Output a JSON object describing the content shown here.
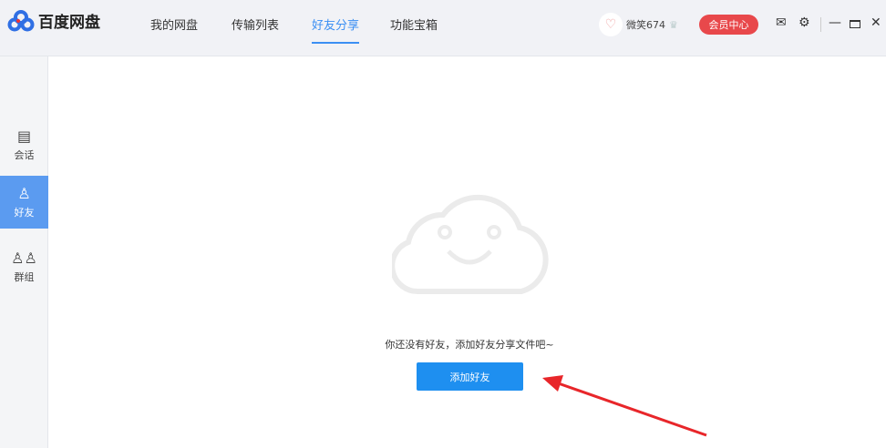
{
  "app": {
    "name": "百度网盘"
  },
  "nav": [
    {
      "label": "我的网盘"
    },
    {
      "label": "传输列表"
    },
    {
      "label": "好友分享",
      "active": true
    },
    {
      "label": "功能宝箱"
    }
  ],
  "user": {
    "name": "微笑674",
    "vip_label": "会员中心"
  },
  "sidebar": [
    {
      "label": "会话",
      "icon": "chat-icon"
    },
    {
      "label": "好友",
      "icon": "user-icon",
      "active": true
    },
    {
      "label": "群组",
      "icon": "group-icon"
    }
  ],
  "main": {
    "empty_text": "你还没有好友，添加好友分享文件吧~",
    "add_button": "添加好友"
  },
  "colors": {
    "accent": "#1e8ff0",
    "vip": "#e8484b",
    "arrow": "#e8262a"
  }
}
